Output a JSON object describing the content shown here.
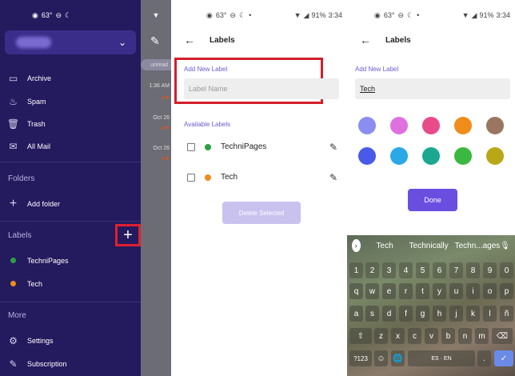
{
  "status": {
    "left_temp": "63°",
    "battery": "91%",
    "time": "3:34"
  },
  "drawer": {
    "items": [
      {
        "label": "Archive",
        "icon": "archive-icon"
      },
      {
        "label": "Spam",
        "icon": "spam-icon"
      },
      {
        "label": "Trash",
        "icon": "trash-icon"
      },
      {
        "label": "All Mail",
        "icon": "all-mail-icon"
      }
    ],
    "folders_heading": "Folders",
    "add_folder": "Add folder",
    "labels_heading": "Labels",
    "labels": [
      {
        "label": "TechniPages",
        "color": "#2ea043"
      },
      {
        "label": "Tech",
        "color": "#f08c1a"
      }
    ],
    "more_heading": "More",
    "settings": "Settings",
    "subscription": "Subscription"
  },
  "mail_peek": {
    "badge": "unread",
    "times": [
      "1:36 AM",
      "Oct 26",
      "Oct 26"
    ]
  },
  "labels_screen": {
    "title": "Labels",
    "add_new_label": "Add New Label",
    "placeholder": "Label Name",
    "available_labels": "Available Labels",
    "labels": [
      {
        "label": "TechniPages",
        "color": "#2ea043"
      },
      {
        "label": "Tech",
        "color": "#f08c1a"
      }
    ],
    "delete_button": "Delete Selected"
  },
  "new_label_screen": {
    "title": "Labels",
    "add_new_label": "Add New Label",
    "input_value": "Tech",
    "colors": [
      "#8a8ef0",
      "#e070e0",
      "#e84a8a",
      "#f08c1a",
      "#9a7560",
      "#4a5ae8",
      "#2aa8e8",
      "#1aa890",
      "#3ab840",
      "#b8a818"
    ],
    "done_button": "Done"
  },
  "keyboard": {
    "suggestions": [
      "Tech",
      "Technically",
      "Techn...ages"
    ],
    "row_numbers": [
      "1",
      "2",
      "3",
      "4",
      "5",
      "6",
      "7",
      "8",
      "9",
      "0"
    ],
    "row1": [
      "q",
      "w",
      "e",
      "r",
      "t",
      "y",
      "u",
      "i",
      "o",
      "p"
    ],
    "row2": [
      "a",
      "s",
      "d",
      "f",
      "g",
      "h",
      "j",
      "k",
      "l",
      "ñ"
    ],
    "row3": [
      "z",
      "x",
      "c",
      "v",
      "b",
      "n",
      "m"
    ],
    "symbols_key": "?123",
    "space_label": "ES · EN",
    "period": "."
  }
}
